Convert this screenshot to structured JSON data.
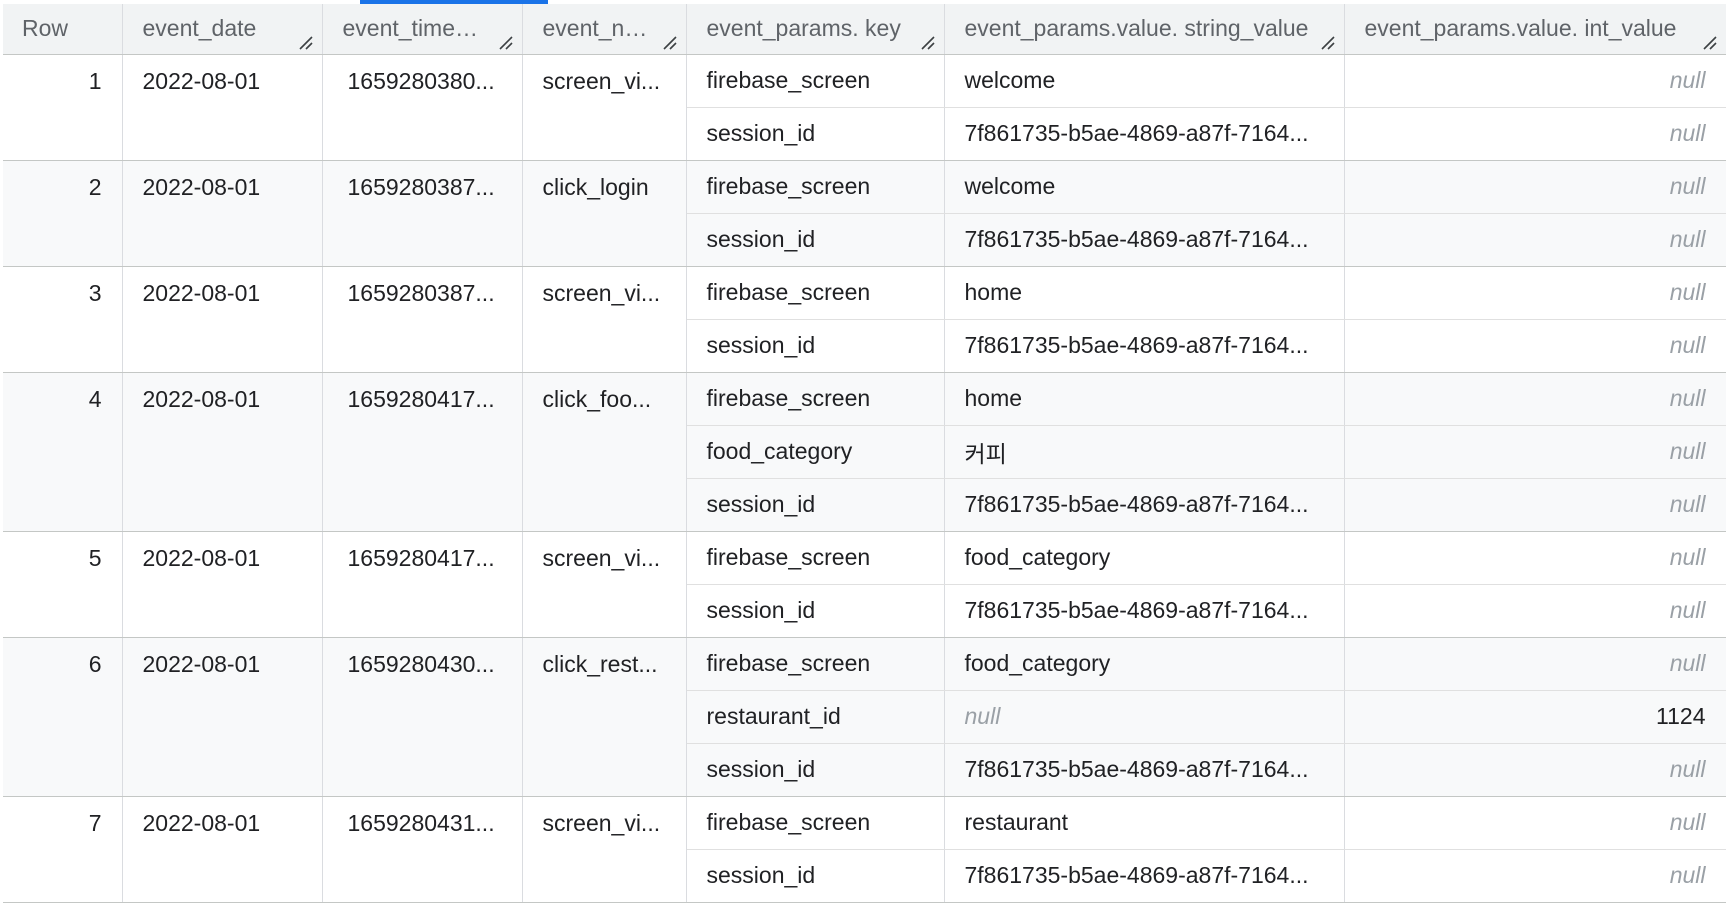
{
  "columns": {
    "row": "Row",
    "event_date": "event_date",
    "event_timestamp": "event_timest...",
    "event_name": "event_na...",
    "key": "event_params. key",
    "string_value": "event_params.value. string_value",
    "int_value": "event_params.value. int_value"
  },
  "rows": [
    {
      "row": "1",
      "event_date": "2022-08-01",
      "event_timestamp": "1659280380...",
      "event_name": "screen_vi...",
      "params": [
        {
          "key": "firebase_screen",
          "string_value": "welcome",
          "int_value": "null"
        },
        {
          "key": "session_id",
          "string_value": "7f861735-b5ae-4869-a87f-7164...",
          "int_value": "null"
        }
      ]
    },
    {
      "row": "2",
      "event_date": "2022-08-01",
      "event_timestamp": "1659280387...",
      "event_name": "click_login",
      "params": [
        {
          "key": "firebase_screen",
          "string_value": "welcome",
          "int_value": "null"
        },
        {
          "key": "session_id",
          "string_value": "7f861735-b5ae-4869-a87f-7164...",
          "int_value": "null"
        }
      ]
    },
    {
      "row": "3",
      "event_date": "2022-08-01",
      "event_timestamp": "1659280387...",
      "event_name": "screen_vi...",
      "params": [
        {
          "key": "firebase_screen",
          "string_value": "home",
          "int_value": "null"
        },
        {
          "key": "session_id",
          "string_value": "7f861735-b5ae-4869-a87f-7164...",
          "int_value": "null"
        }
      ]
    },
    {
      "row": "4",
      "event_date": "2022-08-01",
      "event_timestamp": "1659280417...",
      "event_name": "click_foo...",
      "params": [
        {
          "key": "firebase_screen",
          "string_value": "home",
          "int_value": "null"
        },
        {
          "key": "food_category",
          "string_value": "커피",
          "int_value": "null"
        },
        {
          "key": "session_id",
          "string_value": "7f861735-b5ae-4869-a87f-7164...",
          "int_value": "null"
        }
      ]
    },
    {
      "row": "5",
      "event_date": "2022-08-01",
      "event_timestamp": "1659280417...",
      "event_name": "screen_vi...",
      "params": [
        {
          "key": "firebase_screen",
          "string_value": "food_category",
          "int_value": "null"
        },
        {
          "key": "session_id",
          "string_value": "7f861735-b5ae-4869-a87f-7164...",
          "int_value": "null"
        }
      ]
    },
    {
      "row": "6",
      "event_date": "2022-08-01",
      "event_timestamp": "1659280430...",
      "event_name": "click_rest...",
      "params": [
        {
          "key": "firebase_screen",
          "string_value": "food_category",
          "int_value": "null"
        },
        {
          "key": "restaurant_id",
          "string_value": "null",
          "int_value": "1124"
        },
        {
          "key": "session_id",
          "string_value": "7f861735-b5ae-4869-a87f-7164...",
          "int_value": "null"
        }
      ]
    },
    {
      "row": "7",
      "event_date": "2022-08-01",
      "event_timestamp": "1659280431...",
      "event_name": "screen_vi...",
      "params": [
        {
          "key": "firebase_screen",
          "string_value": "restaurant",
          "int_value": "null"
        },
        {
          "key": "session_id",
          "string_value": "7f861735-b5ae-4869-a87f-7164...",
          "int_value": "null"
        }
      ]
    }
  ],
  "colors": {
    "accent": "#1a73e8",
    "header_bg": "#f1f3f4",
    "alt_row_bg": "#f8f9fa",
    "null_text": "#9aa0a6"
  }
}
